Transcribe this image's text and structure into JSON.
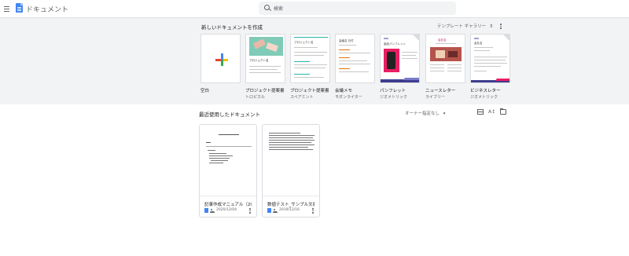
{
  "app": {
    "title": "ドキュメント",
    "brand_color": "#4285f4"
  },
  "search": {
    "placeholder": "検索"
  },
  "templates": {
    "heading": "新しいドキュメントを作成",
    "gallery_label": "テンプレート ギャラリー",
    "items": [
      {
        "name": "空白",
        "sub": ""
      },
      {
        "name": "プロジェクト提案書",
        "sub": "トロピカル"
      },
      {
        "name": "プロジェクト提案書",
        "sub": "スペアミント"
      },
      {
        "name": "会議メモ",
        "sub": "モダンライター"
      },
      {
        "name": "パンフレット",
        "sub": "ジオメトリック"
      },
      {
        "name": "ニュースレター",
        "sub": "ライブリー"
      },
      {
        "name": "ビジネスレター",
        "sub": "ジオメトリック"
      }
    ]
  },
  "recent": {
    "heading": "最近使用したドキュメント",
    "owner_filter": "オーナー指定なし",
    "documents": [
      {
        "title": "記事作成マニュアル（202...",
        "date": "2020/12/04"
      },
      {
        "title": "数値テスト_サンプル文書",
        "date": "2019/12/16"
      }
    ]
  },
  "thumbnail_text": {
    "tropical_title": "プロジェクト名",
    "spearmint_title": "プロジェクト名",
    "memo_title": "会議名 日付",
    "brochure_title": "製品パンフレット",
    "newsletter_title": "会社名",
    "letter_title": "会社名"
  }
}
